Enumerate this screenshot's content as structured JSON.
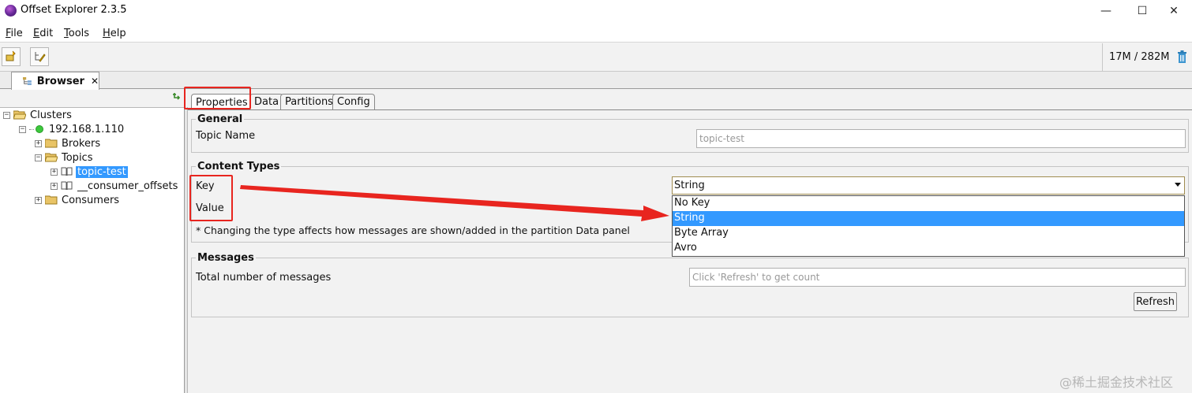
{
  "window": {
    "title": "Offset Explorer  2.3.5",
    "controls": [
      "—",
      "☐",
      "✕"
    ]
  },
  "menu": [
    {
      "mnemonic": "F",
      "rest": "ile"
    },
    {
      "mnemonic": "E",
      "rest": "dit"
    },
    {
      "mnemonic": "T",
      "rest": "ools"
    },
    {
      "mnemonic": "H",
      "rest": "elp"
    }
  ],
  "toolbar": {
    "memory": "17M / 282M"
  },
  "browser_tab": {
    "label": "Browser",
    "close": "✕"
  },
  "tree": {
    "clusters": "Clusters",
    "host": "192.168.1.110",
    "brokers": "Brokers",
    "topics": "Topics",
    "topic_selected": "topic-test",
    "topic_other": "__consumer_offsets",
    "consumers": "Consumers"
  },
  "tabs": [
    "Properties",
    "Data",
    "Partitions",
    "Config"
  ],
  "general": {
    "title": "General",
    "topic_name_label": "Topic Name",
    "topic_name_value": "topic-test"
  },
  "content_types": {
    "title": "Content Types",
    "key_label": "Key",
    "value_label": "Value",
    "note": "* Changing the type affects how messages are shown/added in the partition Data panel",
    "selected": "String",
    "options": [
      "No Key",
      "String",
      "Byte Array",
      "Avro"
    ],
    "highlighted_option": "String"
  },
  "messages": {
    "title": "Messages",
    "total_label": "Total number of messages",
    "count_placeholder": "Click 'Refresh' to get count",
    "refresh_button": "Refresh"
  },
  "watermark": "@稀土掘金技术社区",
  "colors": {
    "selection": "#3399ff",
    "annotation_red": "#e8251f",
    "status_green": "#3cc83c"
  }
}
